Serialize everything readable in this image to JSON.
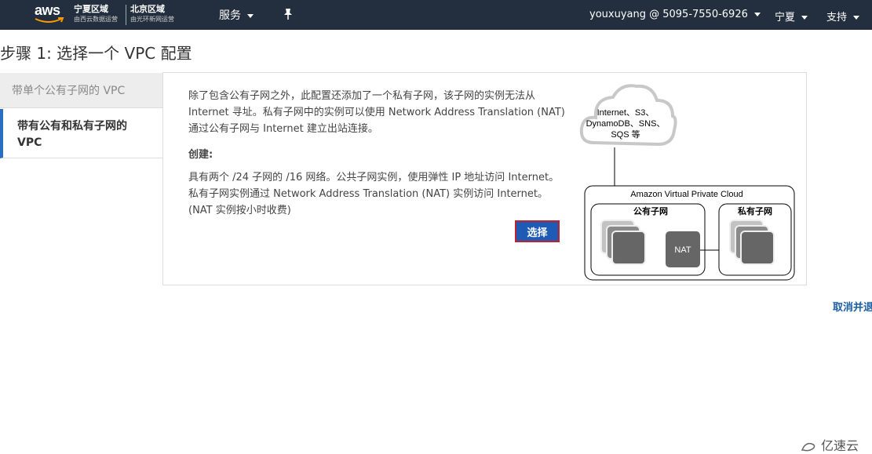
{
  "topnav": {
    "logo_text": "aws",
    "region1": {
      "name": "宁夏区域",
      "sub": "由西云数据运营"
    },
    "region2": {
      "name": "北京区域",
      "sub": "由光环新网运营"
    },
    "services": "服务",
    "account": "youxuyang @ 5095-7550-6926",
    "region_menu": "宁夏",
    "support": "支持"
  },
  "page": {
    "title": "步骤 1: 选择一个 VPC 配置"
  },
  "tabs": [
    {
      "label": "带单个公有子网的 VPC",
      "active": false
    },
    {
      "label": "带有公有和私有子网的 VPC",
      "active": true
    }
  ],
  "main": {
    "description": "除了包含公有子网之外，此配置还添加了一个私有子网，该子网的实例无法从 Internet 寻址。私有子网中的实例可以使用 Network Address Translation (NAT) 通过公有子网与 Internet 建立出站连接。",
    "create_label": "创建:",
    "details": "具有两个 /24 子网的 /16 网络。公共子网实例，使用弹性 IP 地址访问 Internet。私有子网实例通过 Network Address Translation (NAT) 实例访问 Internet。 (NAT 实例按小时收费)",
    "select_button": "选择"
  },
  "diagram": {
    "cloud_line1": "Internet、S3、",
    "cloud_line2": "DynamoDB、SNS、",
    "cloud_line3": "SQS 等",
    "vpc_label": "Amazon Virtual Private Cloud",
    "public_subnet": "公有子网",
    "private_subnet": "私有子网",
    "nat": "NAT"
  },
  "footer": {
    "cancel": "取消并退",
    "watermark": "亿速云"
  },
  "colors": {
    "nav_bg": "#232f3e",
    "accent": "#1f5bb5",
    "tab_active_border": "#2a6fc1",
    "link": "#1a5fa5"
  }
}
